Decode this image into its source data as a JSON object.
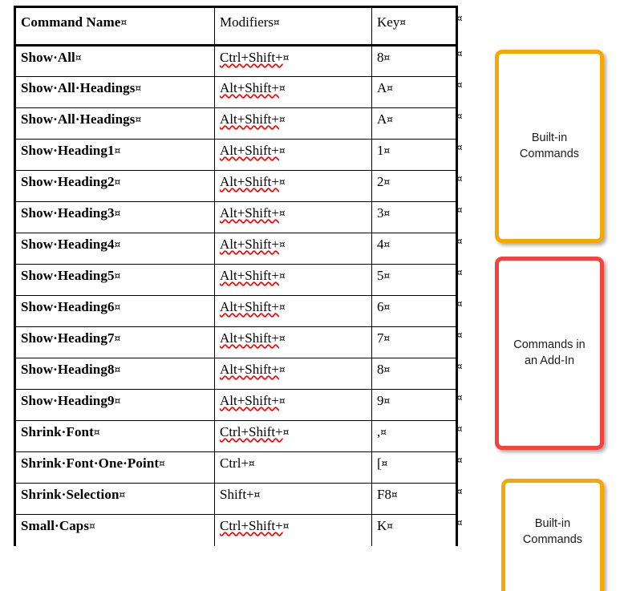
{
  "document": {
    "formatting_marks": {
      "end_of_cell": "¤",
      "space_dot": "·"
    },
    "table": {
      "columns": [
        "Command Name",
        "Modifiers",
        "Key"
      ],
      "rows": [
        {
          "command": "Show·All",
          "modifiers": "Ctrl+Shift+",
          "key": "8",
          "misspelled": true
        },
        {
          "command": "Show·All·Headings",
          "modifiers": "Alt+Shift+",
          "key": "A",
          "misspelled": true
        },
        {
          "command": "Show·All·Headings",
          "modifiers": "Alt+Shift+",
          "key": "A",
          "misspelled": true
        },
        {
          "command": "Show·Heading1",
          "modifiers": "Alt+Shift+",
          "key": "1",
          "misspelled": true
        },
        {
          "command": "Show·Heading2",
          "modifiers": "Alt+Shift+",
          "key": "2",
          "misspelled": true
        },
        {
          "command": "Show·Heading3",
          "modifiers": "Alt+Shift+",
          "key": "3",
          "misspelled": true
        },
        {
          "command": "Show·Heading4",
          "modifiers": "Alt+Shift+",
          "key": "4",
          "misspelled": true
        },
        {
          "command": "Show·Heading5",
          "modifiers": "Alt+Shift+",
          "key": "5",
          "misspelled": true
        },
        {
          "command": "Show·Heading6",
          "modifiers": "Alt+Shift+",
          "key": "6",
          "misspelled": true
        },
        {
          "command": "Show·Heading7",
          "modifiers": "Alt+Shift+",
          "key": "7",
          "misspelled": true
        },
        {
          "command": "Show·Heading8",
          "modifiers": "Alt+Shift+",
          "key": "8",
          "misspelled": true
        },
        {
          "command": "Show·Heading9",
          "modifiers": "Alt+Shift+",
          "key": "9",
          "misspelled": true
        },
        {
          "command": "Shrink·Font",
          "modifiers": "Ctrl+Shift+",
          "key": ",",
          "misspelled": true
        },
        {
          "command": "Shrink·Font·One·Point",
          "modifiers": "Ctrl+",
          "key": "[",
          "misspelled": false
        },
        {
          "command": "Shrink·Selection",
          "modifiers": "Shift+",
          "key": "F8",
          "misspelled": false
        },
        {
          "command": "Small·Caps",
          "modifiers": "Ctrl+Shift+",
          "key": "K",
          "misspelled": true
        }
      ]
    }
  },
  "callouts": [
    {
      "id": "builtin-top",
      "label": "Built-in\nCommands",
      "color": "#f5a800"
    },
    {
      "id": "addin",
      "label": "Commands in\nan Add-In",
      "color": "#f5423c"
    },
    {
      "id": "builtin-bottom",
      "label": "Built-in\nCommands",
      "color": "#f5a800"
    }
  ]
}
